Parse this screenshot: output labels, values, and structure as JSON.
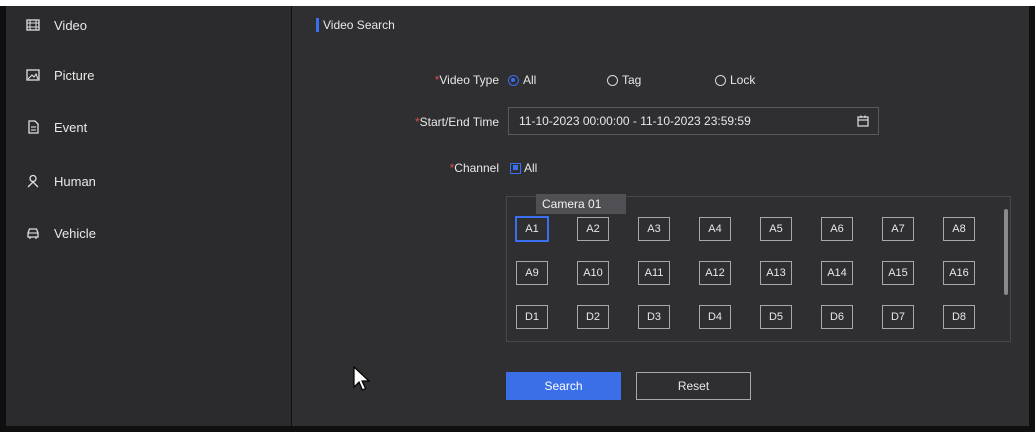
{
  "sidebar": {
    "items": [
      {
        "label": "Video",
        "icon": "film-icon"
      },
      {
        "label": "Picture",
        "icon": "picture-icon"
      },
      {
        "label": "Event",
        "icon": "document-icon"
      },
      {
        "label": "Human",
        "icon": "person-icon"
      },
      {
        "label": "Vehicle",
        "icon": "car-icon"
      }
    ]
  },
  "main": {
    "section_title": "Video Search",
    "video_type": {
      "label": "Video Type",
      "required_mark": "*",
      "options": [
        {
          "label": "All",
          "checked": true
        },
        {
          "label": "Tag",
          "checked": false
        },
        {
          "label": "Lock",
          "checked": false
        }
      ]
    },
    "time_range": {
      "label": "Start/End Time",
      "required_mark": "*",
      "value": "11-10-2023 00:00:00 - 11-10-2023 23:59:59"
    },
    "channel": {
      "label": "Channel",
      "required_mark": "*",
      "all_label": "All",
      "all_checked": true,
      "tooltip": "Camera 01",
      "rows": [
        [
          "A1",
          "A2",
          "A3",
          "A4",
          "A5",
          "A6",
          "A7",
          "A8"
        ],
        [
          "A9",
          "A10",
          "A11",
          "A12",
          "A13",
          "A14",
          "A15",
          "A16"
        ],
        [
          "D1",
          "D2",
          "D3",
          "D4",
          "D5",
          "D6",
          "D7",
          "D8"
        ]
      ]
    },
    "search_label": "Search",
    "reset_label": "Reset"
  },
  "colors": {
    "accent": "#3b6fe8",
    "required": "#e04848",
    "sidebar_bg": "#2b2b2e",
    "main_bg": "#2f2f32"
  }
}
